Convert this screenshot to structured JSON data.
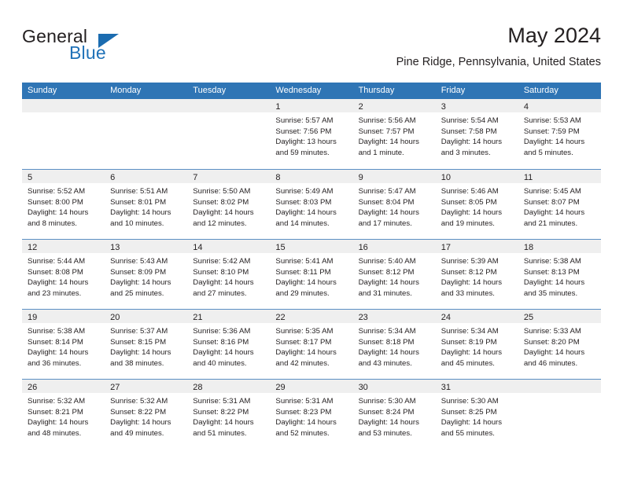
{
  "brand": {
    "name_top": "General",
    "name_bottom": "Blue",
    "triangle_icon": "blue-triangle-icon",
    "accent_color": "#1b6cb0"
  },
  "header": {
    "title": "May 2024",
    "subtitle": "Pine Ridge, Pennsylvania, United States"
  },
  "calendar": {
    "header_bg": "#2f75b5",
    "day_band_bg": "#efefef",
    "row_border": "#5b8fc4",
    "weekdays": [
      "Sunday",
      "Monday",
      "Tuesday",
      "Wednesday",
      "Thursday",
      "Friday",
      "Saturday"
    ],
    "weeks": [
      [
        {
          "day": "",
          "lines": []
        },
        {
          "day": "",
          "lines": []
        },
        {
          "day": "",
          "lines": []
        },
        {
          "day": "1",
          "lines": [
            "Sunrise: 5:57 AM",
            "Sunset: 7:56 PM",
            "Daylight: 13 hours",
            "and 59 minutes."
          ]
        },
        {
          "day": "2",
          "lines": [
            "Sunrise: 5:56 AM",
            "Sunset: 7:57 PM",
            "Daylight: 14 hours",
            "and 1 minute."
          ]
        },
        {
          "day": "3",
          "lines": [
            "Sunrise: 5:54 AM",
            "Sunset: 7:58 PM",
            "Daylight: 14 hours",
            "and 3 minutes."
          ]
        },
        {
          "day": "4",
          "lines": [
            "Sunrise: 5:53 AM",
            "Sunset: 7:59 PM",
            "Daylight: 14 hours",
            "and 5 minutes."
          ]
        }
      ],
      [
        {
          "day": "5",
          "lines": [
            "Sunrise: 5:52 AM",
            "Sunset: 8:00 PM",
            "Daylight: 14 hours",
            "and 8 minutes."
          ]
        },
        {
          "day": "6",
          "lines": [
            "Sunrise: 5:51 AM",
            "Sunset: 8:01 PM",
            "Daylight: 14 hours",
            "and 10 minutes."
          ]
        },
        {
          "day": "7",
          "lines": [
            "Sunrise: 5:50 AM",
            "Sunset: 8:02 PM",
            "Daylight: 14 hours",
            "and 12 minutes."
          ]
        },
        {
          "day": "8",
          "lines": [
            "Sunrise: 5:49 AM",
            "Sunset: 8:03 PM",
            "Daylight: 14 hours",
            "and 14 minutes."
          ]
        },
        {
          "day": "9",
          "lines": [
            "Sunrise: 5:47 AM",
            "Sunset: 8:04 PM",
            "Daylight: 14 hours",
            "and 17 minutes."
          ]
        },
        {
          "day": "10",
          "lines": [
            "Sunrise: 5:46 AM",
            "Sunset: 8:05 PM",
            "Daylight: 14 hours",
            "and 19 minutes."
          ]
        },
        {
          "day": "11",
          "lines": [
            "Sunrise: 5:45 AM",
            "Sunset: 8:07 PM",
            "Daylight: 14 hours",
            "and 21 minutes."
          ]
        }
      ],
      [
        {
          "day": "12",
          "lines": [
            "Sunrise: 5:44 AM",
            "Sunset: 8:08 PM",
            "Daylight: 14 hours",
            "and 23 minutes."
          ]
        },
        {
          "day": "13",
          "lines": [
            "Sunrise: 5:43 AM",
            "Sunset: 8:09 PM",
            "Daylight: 14 hours",
            "and 25 minutes."
          ]
        },
        {
          "day": "14",
          "lines": [
            "Sunrise: 5:42 AM",
            "Sunset: 8:10 PM",
            "Daylight: 14 hours",
            "and 27 minutes."
          ]
        },
        {
          "day": "15",
          "lines": [
            "Sunrise: 5:41 AM",
            "Sunset: 8:11 PM",
            "Daylight: 14 hours",
            "and 29 minutes."
          ]
        },
        {
          "day": "16",
          "lines": [
            "Sunrise: 5:40 AM",
            "Sunset: 8:12 PM",
            "Daylight: 14 hours",
            "and 31 minutes."
          ]
        },
        {
          "day": "17",
          "lines": [
            "Sunrise: 5:39 AM",
            "Sunset: 8:12 PM",
            "Daylight: 14 hours",
            "and 33 minutes."
          ]
        },
        {
          "day": "18",
          "lines": [
            "Sunrise: 5:38 AM",
            "Sunset: 8:13 PM",
            "Daylight: 14 hours",
            "and 35 minutes."
          ]
        }
      ],
      [
        {
          "day": "19",
          "lines": [
            "Sunrise: 5:38 AM",
            "Sunset: 8:14 PM",
            "Daylight: 14 hours",
            "and 36 minutes."
          ]
        },
        {
          "day": "20",
          "lines": [
            "Sunrise: 5:37 AM",
            "Sunset: 8:15 PM",
            "Daylight: 14 hours",
            "and 38 minutes."
          ]
        },
        {
          "day": "21",
          "lines": [
            "Sunrise: 5:36 AM",
            "Sunset: 8:16 PM",
            "Daylight: 14 hours",
            "and 40 minutes."
          ]
        },
        {
          "day": "22",
          "lines": [
            "Sunrise: 5:35 AM",
            "Sunset: 8:17 PM",
            "Daylight: 14 hours",
            "and 42 minutes."
          ]
        },
        {
          "day": "23",
          "lines": [
            "Sunrise: 5:34 AM",
            "Sunset: 8:18 PM",
            "Daylight: 14 hours",
            "and 43 minutes."
          ]
        },
        {
          "day": "24",
          "lines": [
            "Sunrise: 5:34 AM",
            "Sunset: 8:19 PM",
            "Daylight: 14 hours",
            "and 45 minutes."
          ]
        },
        {
          "day": "25",
          "lines": [
            "Sunrise: 5:33 AM",
            "Sunset: 8:20 PM",
            "Daylight: 14 hours",
            "and 46 minutes."
          ]
        }
      ],
      [
        {
          "day": "26",
          "lines": [
            "Sunrise: 5:32 AM",
            "Sunset: 8:21 PM",
            "Daylight: 14 hours",
            "and 48 minutes."
          ]
        },
        {
          "day": "27",
          "lines": [
            "Sunrise: 5:32 AM",
            "Sunset: 8:22 PM",
            "Daylight: 14 hours",
            "and 49 minutes."
          ]
        },
        {
          "day": "28",
          "lines": [
            "Sunrise: 5:31 AM",
            "Sunset: 8:22 PM",
            "Daylight: 14 hours",
            "and 51 minutes."
          ]
        },
        {
          "day": "29",
          "lines": [
            "Sunrise: 5:31 AM",
            "Sunset: 8:23 PM",
            "Daylight: 14 hours",
            "and 52 minutes."
          ]
        },
        {
          "day": "30",
          "lines": [
            "Sunrise: 5:30 AM",
            "Sunset: 8:24 PM",
            "Daylight: 14 hours",
            "and 53 minutes."
          ]
        },
        {
          "day": "31",
          "lines": [
            "Sunrise: 5:30 AM",
            "Sunset: 8:25 PM",
            "Daylight: 14 hours",
            "and 55 minutes."
          ]
        },
        {
          "day": "",
          "lines": []
        }
      ]
    ]
  }
}
